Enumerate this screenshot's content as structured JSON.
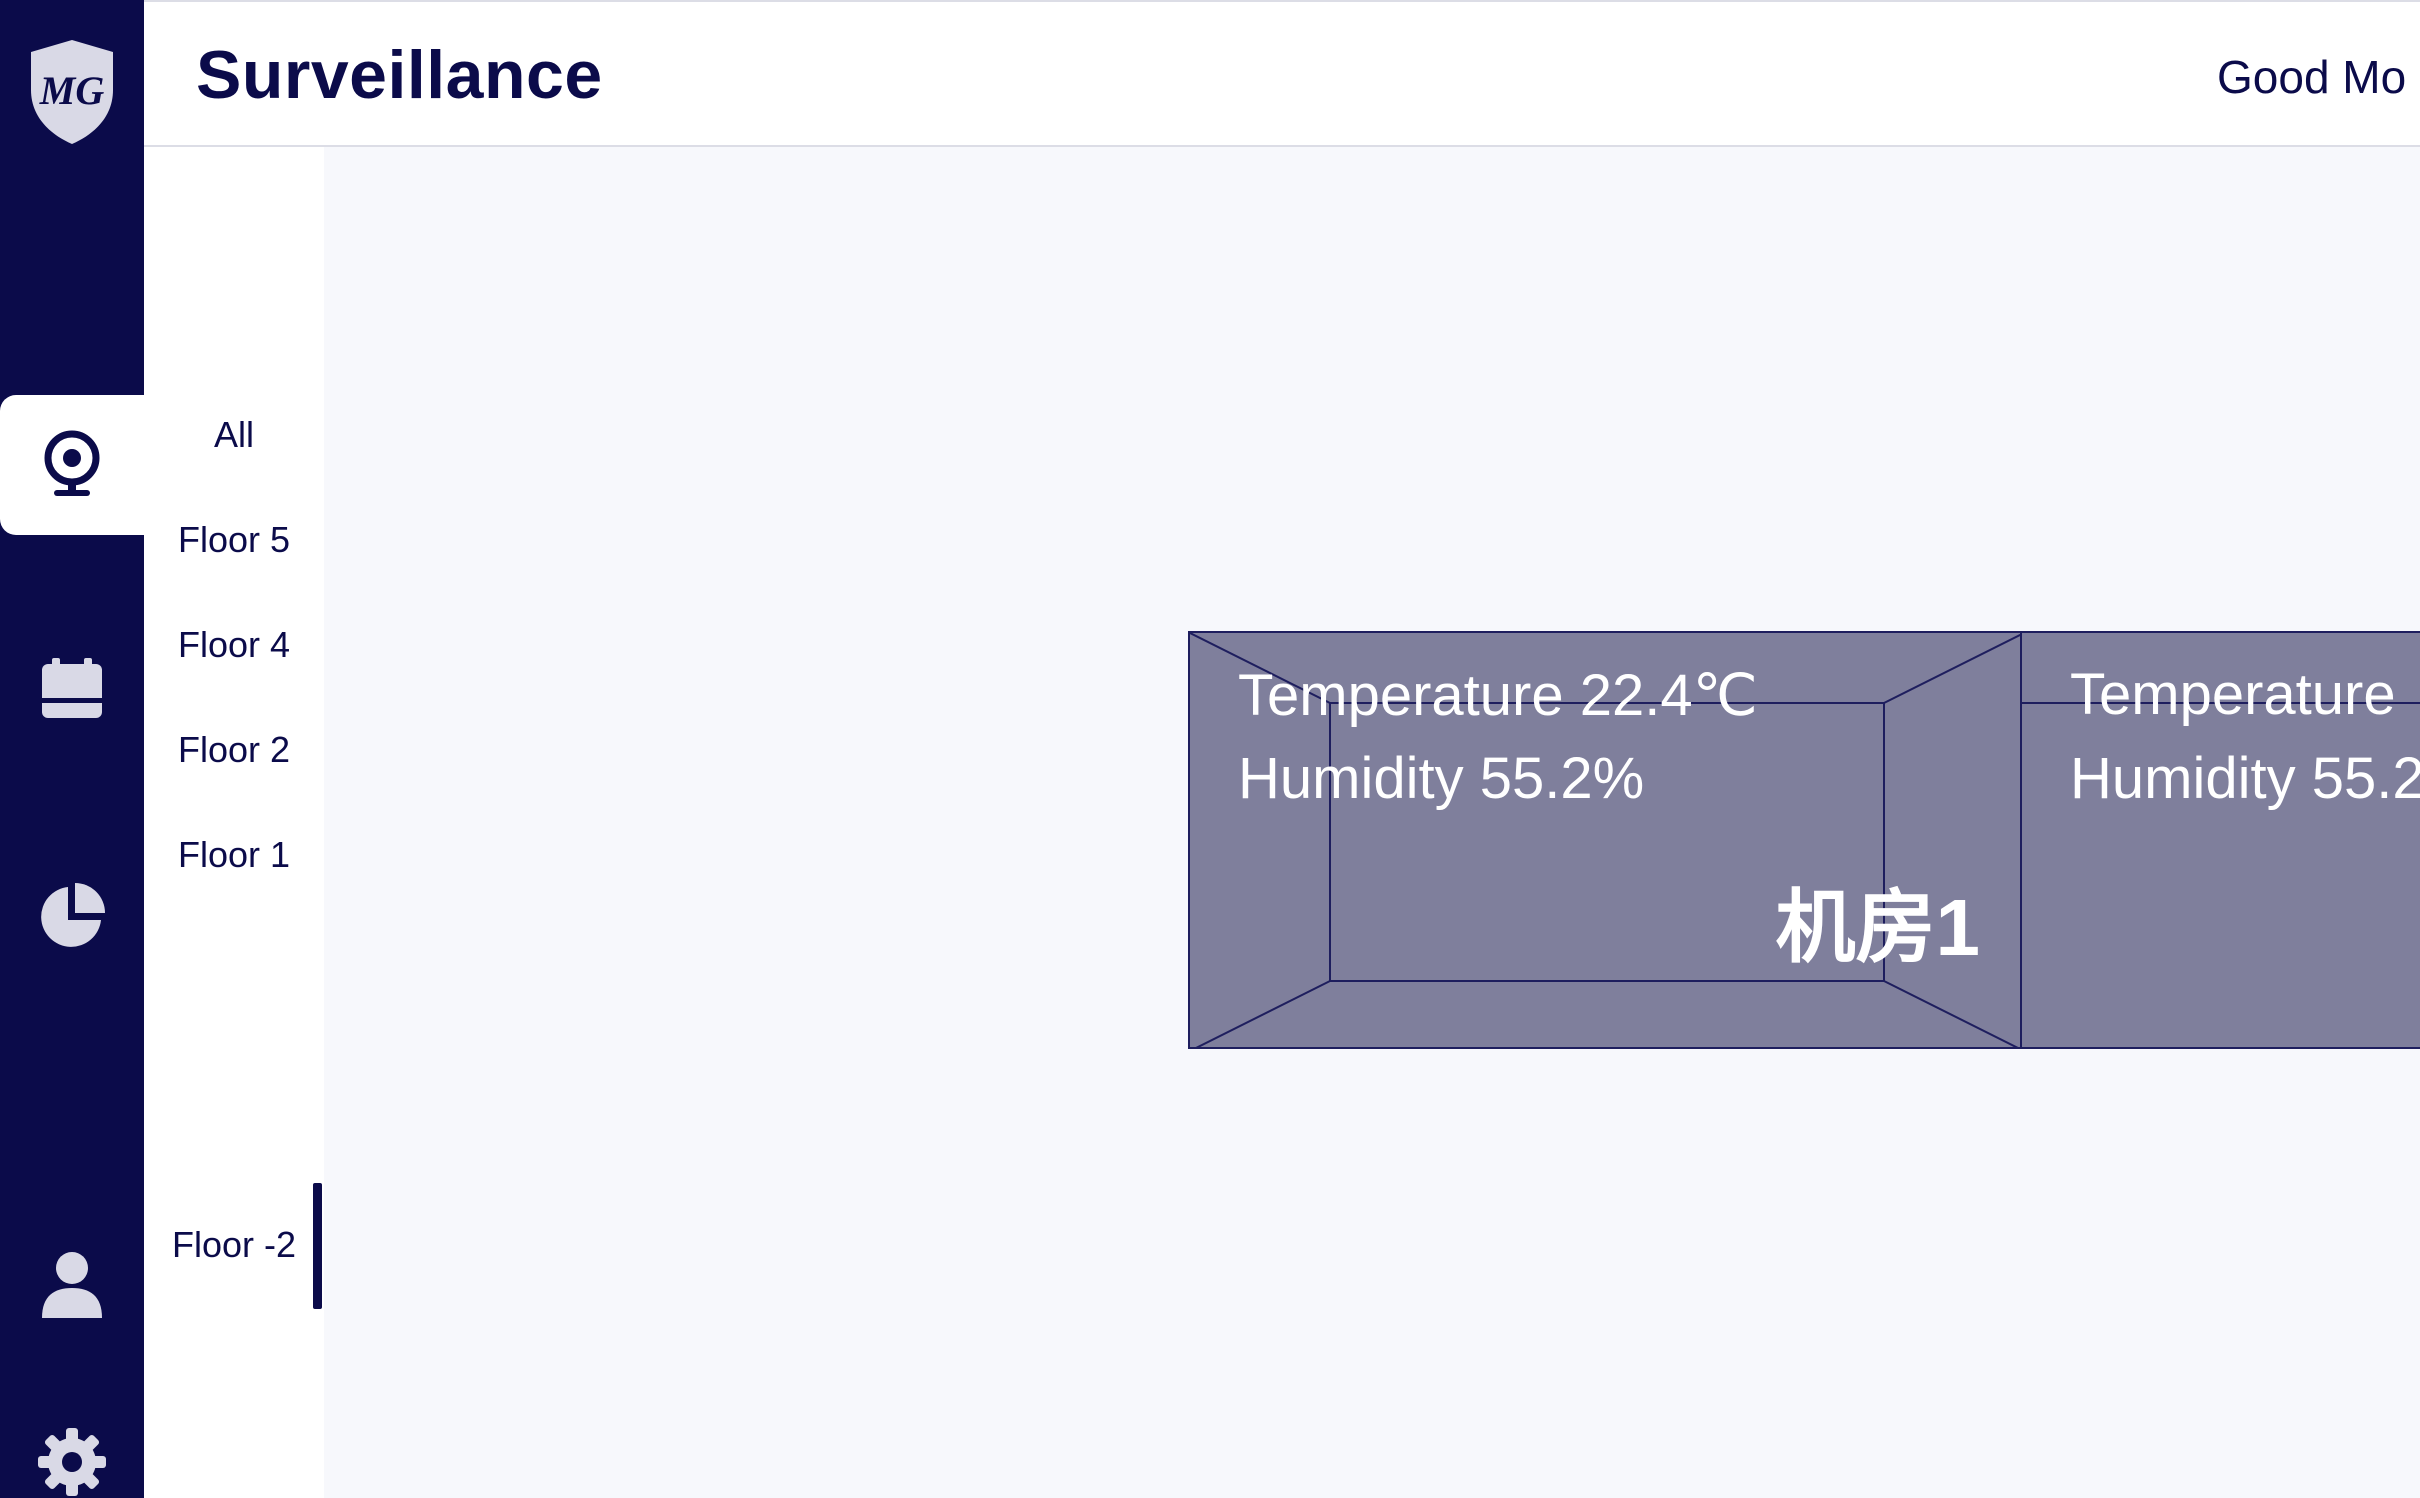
{
  "header": {
    "title": "Surveillance",
    "greeting": "Good Mo"
  },
  "nav": {
    "items": [
      {
        "id": "surveillance",
        "icon": "webcam-icon",
        "active": true
      },
      {
        "id": "schedule",
        "icon": "calendar-icon",
        "active": false
      },
      {
        "id": "statistics",
        "icon": "pie-chart-icon",
        "active": false
      },
      {
        "id": "user",
        "icon": "user-icon",
        "active": false
      },
      {
        "id": "settings",
        "icon": "gear-icon",
        "active": false
      }
    ]
  },
  "floors": {
    "items": [
      "All",
      "Floor 5",
      "Floor 4",
      "Floor 2",
      "Floor 1",
      "Floor -2"
    ],
    "selected": "Floor -2"
  },
  "rooms": [
    {
      "name": "机房1",
      "temperature": "Temperature 22.4℃",
      "humidity": "Humidity 55.2%"
    },
    {
      "name": "",
      "temperature": "Temperature",
      "humidity": "Humidity 55.2"
    }
  ],
  "colors": {
    "navy": "#0b0b4a",
    "room_fill": "#7f7f9c",
    "rail_icon": "#d9d9e6"
  }
}
